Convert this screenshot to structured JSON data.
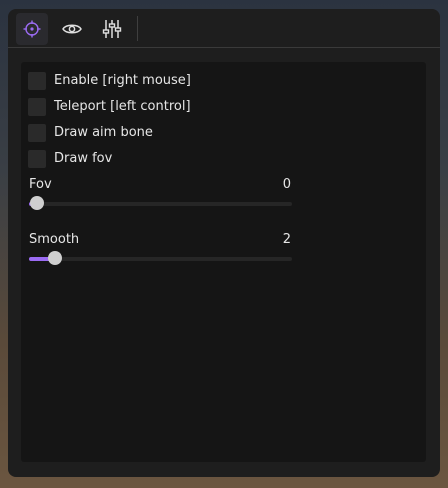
{
  "colors": {
    "accent": "#9b6bf2",
    "window_bg": "#1e1e1e",
    "panel_bg": "#151515",
    "text": "#e6e6e6"
  },
  "tabs": [
    {
      "icon": "crosshair-icon",
      "active": true
    },
    {
      "icon": "eye-icon",
      "active": false
    },
    {
      "icon": "sliders-icon",
      "active": false
    }
  ],
  "checkboxes": [
    {
      "label": "Enable [right mouse]",
      "checked": false
    },
    {
      "label": "Teleport [left control]",
      "checked": false
    },
    {
      "label": "Draw aim bone",
      "checked": false
    },
    {
      "label": "Draw fov",
      "checked": false
    }
  ],
  "sliders": {
    "fov": {
      "label": "Fov",
      "value": "0",
      "fraction": 0.03
    },
    "smooth": {
      "label": "Smooth",
      "value": "2",
      "fraction": 0.1
    }
  }
}
